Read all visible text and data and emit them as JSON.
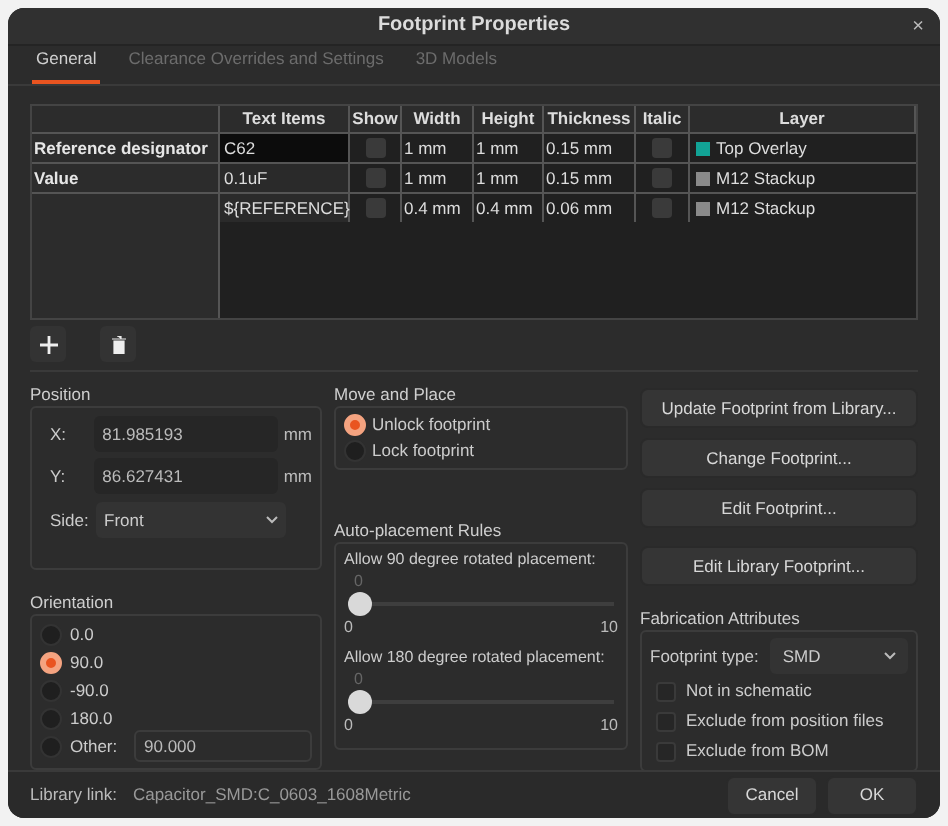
{
  "window": {
    "title": "Footprint Properties",
    "close": "×"
  },
  "tabs": [
    {
      "label": "General",
      "selected": true
    },
    {
      "label": "Clearance Overrides and Settings",
      "selected": false
    },
    {
      "label": "3D Models",
      "selected": false
    }
  ],
  "text_items": {
    "columns": [
      "Text Items",
      "Show",
      "Width",
      "Height",
      "Thickness",
      "Italic",
      "Layer"
    ],
    "rows": [
      {
        "name": "Reference designator",
        "text": "C62",
        "show": false,
        "width": "1 mm",
        "height": "1 mm",
        "thickness": "0.15 mm",
        "italic": false,
        "layer": "Top Overlay",
        "color": "#12a396",
        "selected": true
      },
      {
        "name": "Value",
        "text": "0.1uF",
        "show": false,
        "width": "1 mm",
        "height": "1 mm",
        "thickness": "0.15 mm",
        "italic": false,
        "layer": "M12 Stackup",
        "color": "#8a8a8a",
        "selected": false
      },
      {
        "text": "${REFERENCE}",
        "show": false,
        "width": "0.4 mm",
        "height": "0.4 mm",
        "thickness": "0.06 mm",
        "italic": false,
        "layer": "M12 Stackup",
        "color": "#8a8a8a",
        "selected": false
      }
    ]
  },
  "position": {
    "title": "Position",
    "fields": [
      {
        "label": "X:",
        "value": "81.985193",
        "unit": "mm"
      },
      {
        "label": "Y:",
        "value": "86.627431",
        "unit": "mm"
      }
    ],
    "side": {
      "label": "Side:",
      "value": "Front"
    }
  },
  "orientation": {
    "title": "Orientation",
    "options": [
      {
        "label": "0.0",
        "selected": false
      },
      {
        "label": "90.0",
        "selected": true
      },
      {
        "label": "-90.0",
        "selected": false
      },
      {
        "label": "180.0",
        "selected": false
      },
      {
        "label": "Other:",
        "selected": false
      }
    ],
    "other_value": "90.000"
  },
  "move_and_place": {
    "title": "Move and Place",
    "options": [
      {
        "label": "Unlock footprint",
        "selected": true
      },
      {
        "label": "Lock footprint",
        "selected": false
      }
    ]
  },
  "auto_placement": {
    "title": "Auto-placement Rules",
    "sliders": [
      {
        "label": "Allow 90 degree rotated placement:",
        "value": "0",
        "level": 0,
        "min": "0",
        "max": "10"
      },
      {
        "label": "Allow 180 degree rotated placement:",
        "value": "0",
        "level": 0,
        "min": "0",
        "max": "10"
      }
    ]
  },
  "actions": [
    "Update Footprint from Library...",
    "Change Footprint...",
    "Edit Footprint...",
    "Edit Library Footprint..."
  ],
  "fabrication": {
    "title": "Fabrication Attributes",
    "type_label": "Footprint type:",
    "type_value": "SMD",
    "checks": [
      {
        "label": "Not in schematic",
        "checked": false
      },
      {
        "label": "Exclude from position files",
        "checked": false
      },
      {
        "label": "Exclude from BOM",
        "checked": false
      }
    ]
  },
  "library_link": {
    "label": "Library link:",
    "value": "Capacitor_SMD:C_0603_1608Metric"
  },
  "buttons": [
    "Cancel",
    "OK"
  ]
}
